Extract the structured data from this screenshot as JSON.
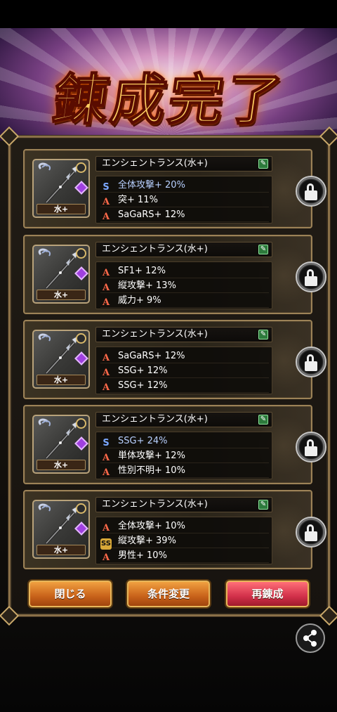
{
  "title": "錬成完了",
  "cards": [
    {
      "name": "エンシェントランス(水+)",
      "element": "水+",
      "stats": [
        {
          "icon": "s-rank-icon",
          "glyph": "S",
          "text": "全体攻撃+ 20%",
          "style": "blue"
        },
        {
          "icon": "a-rank-icon",
          "glyph": "A",
          "text": "突+ 11%",
          "style": "white"
        },
        {
          "icon": "a-rank-icon",
          "glyph": "A",
          "text": "SaGaRS+ 12%",
          "style": "white"
        }
      ]
    },
    {
      "name": "エンシェントランス(水+)",
      "element": "水+",
      "stats": [
        {
          "icon": "a-rank-icon",
          "glyph": "A",
          "text": "SF1+ 12%",
          "style": "white"
        },
        {
          "icon": "a-rank-icon",
          "glyph": "A",
          "text": "縦攻撃+ 13%",
          "style": "white"
        },
        {
          "icon": "a-rank-icon",
          "glyph": "A",
          "text": "威力+ 9%",
          "style": "white"
        }
      ]
    },
    {
      "name": "エンシェントランス(水+)",
      "element": "水+",
      "stats": [
        {
          "icon": "a-rank-icon",
          "glyph": "A",
          "text": "SaGaRS+ 12%",
          "style": "white"
        },
        {
          "icon": "a-rank-icon",
          "glyph": "A",
          "text": "SSG+ 12%",
          "style": "white"
        },
        {
          "icon": "a-rank-icon",
          "glyph": "A",
          "text": "SSG+ 12%",
          "style": "white"
        }
      ]
    },
    {
      "name": "エンシェントランス(水+)",
      "element": "水+",
      "stats": [
        {
          "icon": "s-rank-icon",
          "glyph": "S",
          "text": "SSG+ 24%",
          "style": "blue"
        },
        {
          "icon": "a-rank-icon",
          "glyph": "A",
          "text": "単体攻撃+ 12%",
          "style": "white"
        },
        {
          "icon": "a-rank-icon",
          "glyph": "A",
          "text": "性別不明+ 10%",
          "style": "white"
        }
      ]
    },
    {
      "name": "エンシェントランス(水+)",
      "element": "水+",
      "stats": [
        {
          "icon": "a-rank-icon",
          "glyph": "A",
          "text": "全体攻撃+ 10%",
          "style": "white"
        },
        {
          "icon": "ss-rank-icon",
          "glyph": "SS",
          "text": "縦攻撃+ 39%",
          "style": "white"
        },
        {
          "icon": "a-rank-icon",
          "glyph": "A",
          "text": "男性+ 10%",
          "style": "white"
        }
      ]
    }
  ],
  "buttons": {
    "close": "閉じる",
    "change_conditions": "条件変更",
    "retry": "再錬成"
  },
  "colors": {
    "accent_gold": "#9c8257",
    "button_orange": "#c8621a",
    "button_red": "#d2304a",
    "stat_blue": "#b8d0ff"
  }
}
